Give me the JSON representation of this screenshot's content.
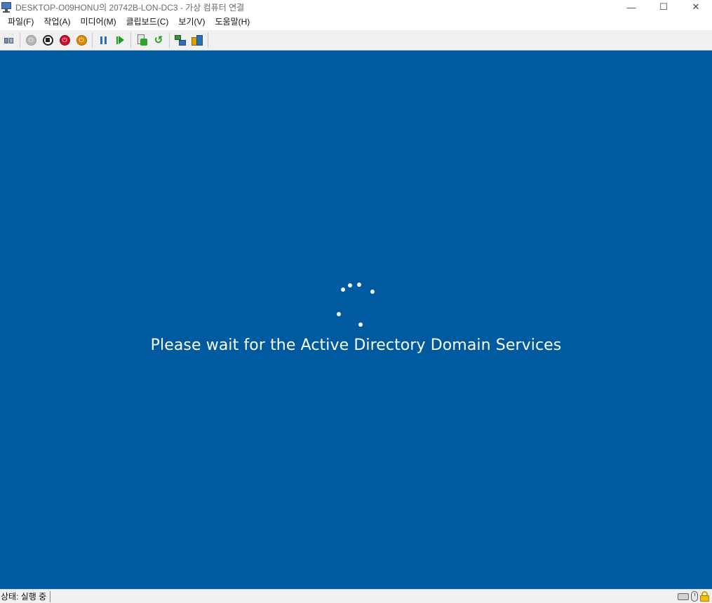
{
  "window": {
    "title": "DESKTOP-O09HONU의 20742B-LON-DC3 - 가상 컴퓨터 연결",
    "controls": {
      "minimize": "—",
      "maximize": "☐",
      "close": "✕"
    }
  },
  "menubar": {
    "items": [
      {
        "label": "파일(F)"
      },
      {
        "label": "작업(A)"
      },
      {
        "label": "미디어(M)"
      },
      {
        "label": "클립보드(C)"
      },
      {
        "label": "보기(V)"
      },
      {
        "label": "도움말(H)"
      }
    ]
  },
  "toolbar": {
    "buttons": [
      {
        "name": "ctrl-alt-del-icon"
      },
      {
        "name": "start-icon"
      },
      {
        "name": "turn-off-icon"
      },
      {
        "name": "shutdown-icon"
      },
      {
        "name": "save-icon"
      },
      {
        "name": "pause-icon"
      },
      {
        "name": "resume-icon"
      },
      {
        "name": "checkpoint-icon"
      },
      {
        "name": "revert-icon"
      },
      {
        "name": "network-icon"
      },
      {
        "name": "enhanced-session-icon"
      }
    ],
    "colors": {
      "power_gray": "#b5b5b5",
      "turn_off_red": "#c8102e",
      "shutdown_orange": "#e08a00",
      "pause_blue": "#1e73be",
      "resume_green": "#1aa01a"
    }
  },
  "vm_screen": {
    "background": "#005aa0",
    "message": "Please wait for the Active Directory Domain Services"
  },
  "statusbar": {
    "status": "상태: 실행 중",
    "icons": [
      "keyboard-icon",
      "mouse-icon",
      "lock-icon"
    ]
  }
}
